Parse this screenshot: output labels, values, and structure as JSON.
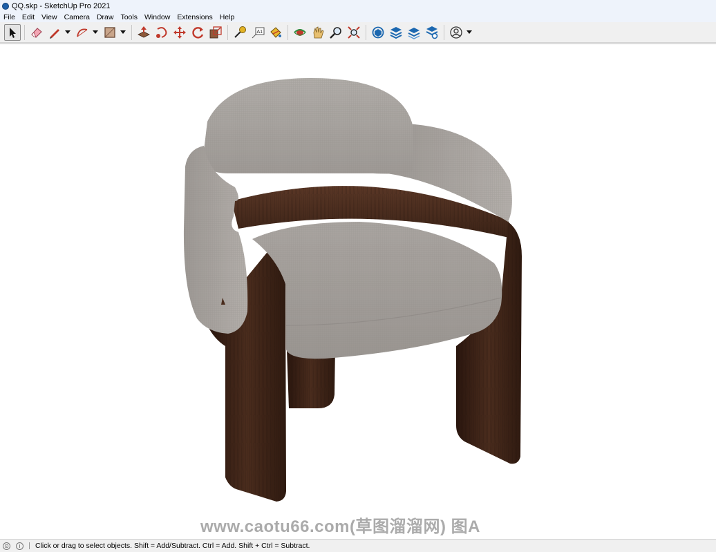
{
  "window": {
    "title": "QQ.skp - SketchUp Pro 2021"
  },
  "menu": [
    "File",
    "Edit",
    "View",
    "Camera",
    "Draw",
    "Tools",
    "Window",
    "Extensions",
    "Help"
  ],
  "toolbar": {
    "tools": [
      {
        "id": "select",
        "icon": "select-arrow-icon",
        "active": true
      },
      {
        "id": "eraser",
        "icon": "eraser-icon"
      },
      {
        "id": "pencil",
        "icon": "pencil-icon",
        "dropdown": true
      },
      {
        "id": "arc",
        "icon": "arc-icon",
        "dropdown": true
      },
      {
        "id": "rectangle",
        "icon": "rectangle-icon",
        "dropdown": true
      },
      {
        "id": "push-pull",
        "icon": "push-pull-icon"
      },
      {
        "id": "follow-me",
        "icon": "follow-me-icon"
      },
      {
        "id": "move",
        "icon": "move-icon"
      },
      {
        "id": "rotate",
        "icon": "rotate-icon"
      },
      {
        "id": "scale",
        "icon": "scale-icon"
      },
      {
        "id": "tape-measure",
        "icon": "tape-measure-icon"
      },
      {
        "id": "text",
        "icon": "text-icon"
      },
      {
        "id": "paint-bucket",
        "icon": "paint-bucket-icon"
      },
      {
        "id": "orbit",
        "icon": "orbit-icon"
      },
      {
        "id": "pan",
        "icon": "pan-icon"
      },
      {
        "id": "zoom",
        "icon": "zoom-icon"
      },
      {
        "id": "zoom-extents",
        "icon": "zoom-extents-icon"
      },
      {
        "id": "warehouse",
        "icon": "3d-warehouse-icon"
      },
      {
        "id": "extension-warehouse",
        "icon": "extension-warehouse-icon"
      },
      {
        "id": "layout",
        "icon": "send-to-layout-icon"
      },
      {
        "id": "extension-manager",
        "icon": "extension-manager-icon"
      },
      {
        "id": "account",
        "icon": "user-account-icon",
        "dropdown": true
      }
    ]
  },
  "viewport": {
    "watermark": "www.caotu66.com(草图溜溜网) 图A"
  },
  "status": {
    "message": "Click or drag to select objects. Shift = Add/Subtract. Ctrl = Add. Shift + Ctrl = Subtract."
  },
  "colors": {
    "fabric": "#a6a19d",
    "wood": "#3e2519",
    "chrome": "#f0f0f0"
  }
}
